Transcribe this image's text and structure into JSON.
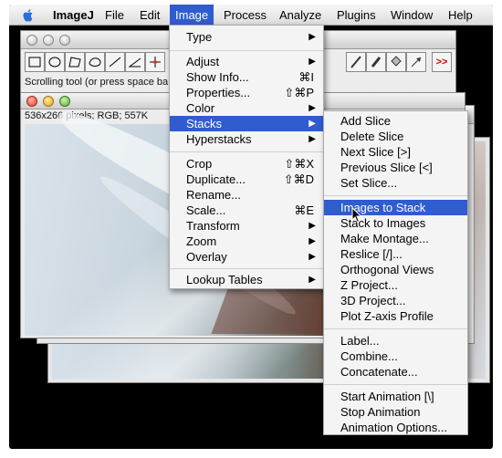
{
  "menubar": {
    "items": [
      "ImageJ",
      "File",
      "Edit",
      "Image",
      "Process",
      "Analyze",
      "Plugins",
      "Window",
      "Help"
    ],
    "active": "Image"
  },
  "toolbar_window": {
    "status": "Scrolling tool (or press space ba",
    "more_symbol": ">>"
  },
  "image_window": {
    "info": "536x266 pixels; RGB; 557K"
  },
  "image_menu": {
    "items": [
      {
        "label": "Type",
        "submenu": true
      },
      {
        "label": "Adjust",
        "submenu": true
      },
      {
        "label": "Show Info...",
        "shortcut": "⌘I"
      },
      {
        "label": "Properties...",
        "shortcut": "⇧⌘P"
      },
      {
        "label": "Color",
        "submenu": true
      },
      {
        "label": "Stacks",
        "submenu": true,
        "selected": true
      },
      {
        "label": "Hyperstacks",
        "submenu": true
      },
      {
        "label": "Crop",
        "shortcut": "⇧⌘X"
      },
      {
        "label": "Duplicate...",
        "shortcut": "⇧⌘D"
      },
      {
        "label": "Rename..."
      },
      {
        "label": "Scale...",
        "shortcut": "⌘E"
      },
      {
        "label": "Transform",
        "submenu": true
      },
      {
        "label": "Zoom",
        "submenu": true
      },
      {
        "label": "Overlay",
        "submenu": true
      },
      {
        "label": "Lookup Tables",
        "submenu": true
      }
    ]
  },
  "stacks_menu": {
    "items": [
      "Add Slice",
      "Delete Slice",
      "Next Slice [>]",
      "Previous Slice [<]",
      "Set Slice...",
      "Images to Stack",
      "Stack to Images",
      "Make Montage...",
      "Reslice [/]...",
      "Orthogonal Views",
      "Z Project...",
      "3D Project...",
      "Plot Z-axis Profile",
      "Label...",
      "Combine...",
      "Concatenate...",
      "Start Animation [\\]",
      "Stop Animation",
      "Animation Options..."
    ],
    "selected": "Images to Stack"
  }
}
